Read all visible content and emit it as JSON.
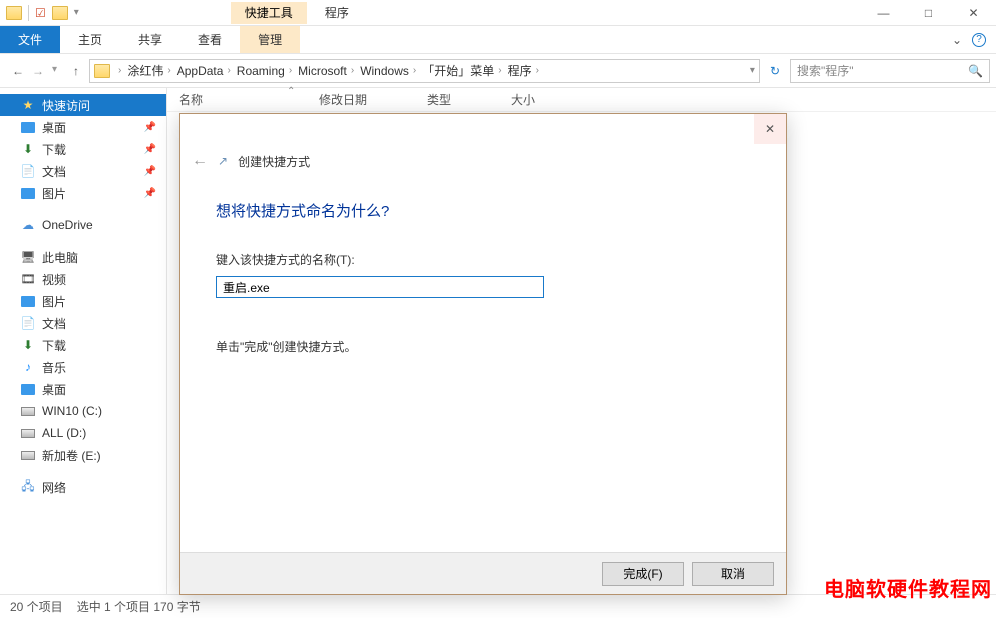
{
  "titlebar": {
    "contextual_tab_group": "快捷工具",
    "app_title": "程序"
  },
  "ribbon": {
    "file": "文件",
    "tabs": [
      "主页",
      "共享",
      "查看"
    ],
    "contextual": "管理"
  },
  "breadcrumb": [
    "涂红伟",
    "AppData",
    "Roaming",
    "Microsoft",
    "Windows",
    "「开始」菜单",
    "程序"
  ],
  "search": {
    "placeholder": "搜索\"程序\""
  },
  "sidebar": {
    "quick_access": "快速访问",
    "quick_items": [
      "桌面",
      "下载",
      "文档",
      "图片"
    ],
    "onedrive": "OneDrive",
    "this_pc": "此电脑",
    "pc_items": [
      "视频",
      "图片",
      "文档",
      "下载",
      "音乐",
      "桌面",
      "WIN10 (C:)",
      "ALL (D:)",
      "新加卷 (E:)"
    ],
    "network": "网络"
  },
  "columns": {
    "name": "名称",
    "modified": "修改日期",
    "type": "类型",
    "size": "大小"
  },
  "status": {
    "items": "20 个项目",
    "selected": "选中 1 个项目 170 字节"
  },
  "dialog": {
    "title": "创建快捷方式",
    "heading": "想将快捷方式命名为什么?",
    "label": "键入该快捷方式的名称(T):",
    "value": "重启.exe",
    "hint": "单击\"完成\"创建快捷方式。",
    "finish": "完成(F)",
    "cancel": "取消"
  },
  "watermark": "电脑软硬件教程网"
}
